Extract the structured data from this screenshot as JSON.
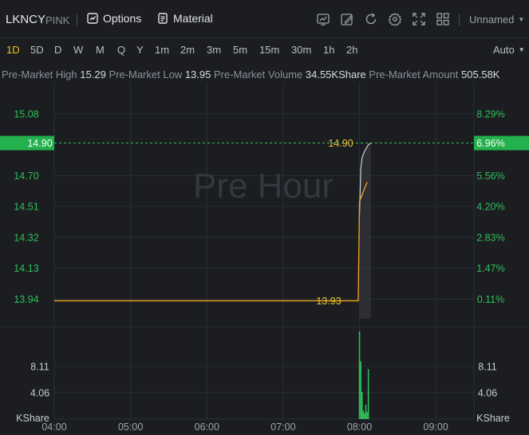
{
  "symbol": "LKNCY",
  "exchange": "PINK",
  "toolbar": {
    "options_label": "Options",
    "material_label": "Material",
    "layout_label": "Unnamed",
    "icons": [
      "indicator-icon",
      "draw-icon",
      "refresh-icon",
      "settings-icon",
      "fullscreen-icon",
      "layout-grid-icon"
    ]
  },
  "periods": [
    "1D",
    "5D",
    "D",
    "W",
    "M",
    "Q",
    "Y",
    "1m",
    "2m",
    "3m",
    "5m",
    "15m",
    "30m",
    "1h",
    "2h"
  ],
  "active_period": "1D",
  "scale_mode": "Auto",
  "stats": {
    "high_label": "Pre-Market High",
    "high": "15.29",
    "low_label": "Pre-Market Low",
    "low": "13.95",
    "volume_label": "Pre-Market Volume",
    "volume": "34.55KShare",
    "amount_label": "Pre-Market Amount",
    "amount": "505.58K"
  },
  "watermark": "Pre Hour",
  "colors": {
    "price_line": "#f5a623",
    "avg_line": "#d0d4da",
    "up": "#2fbf5a",
    "highlight": "#23b04d",
    "tag_text": "#e8c532",
    "grid": "#2a2e34"
  },
  "chart_data": {
    "type": "line",
    "x_ticks": [
      "04:00",
      "05:00",
      "06:00",
      "07:00",
      "08:00",
      "09:00"
    ],
    "y_left_ticks": [
      "15.08",
      "14.70",
      "14.51",
      "14.32",
      "14.13",
      "13.94"
    ],
    "y_right_ticks": [
      "8.29%",
      "5.56%",
      "4.20%",
      "2.83%",
      "1.47%",
      "0.11%"
    ],
    "ylim": [
      13.82,
      15.27
    ],
    "current_price": "14.90",
    "current_change": "6.96%",
    "low_tag": "13.93",
    "high_tag": "14.90",
    "price_series": [
      {
        "t": "04:00",
        "v": 13.93
      },
      {
        "t": "07:00",
        "v": 13.93
      },
      {
        "t": "07:59",
        "v": 13.93
      },
      {
        "t": "08:00",
        "v": 14.54
      },
      {
        "t": "08:03",
        "v": 14.6
      },
      {
        "t": "08:06",
        "v": 14.66
      }
    ],
    "avg_series": [
      {
        "t": "08:00",
        "v": 14.46
      },
      {
        "t": "08:01",
        "v": 14.74
      },
      {
        "t": "08:02",
        "v": 14.81
      },
      {
        "t": "08:04",
        "v": 14.85
      },
      {
        "t": "08:07",
        "v": 14.89
      },
      {
        "t": "08:09",
        "v": 14.9
      }
    ],
    "volume": {
      "unit": "KShare",
      "ticks": [
        "8.11",
        "4.06"
      ],
      "ylim": [
        0,
        14.0
      ],
      "bars": [
        {
          "t": "08:00",
          "v": 13.5
        },
        {
          "t": "08:01",
          "v": 8.9
        },
        {
          "t": "08:02",
          "v": 4.2
        },
        {
          "t": "08:03",
          "v": 1.3
        },
        {
          "t": "08:04",
          "v": 0.9
        },
        {
          "t": "08:05",
          "v": 2.2
        },
        {
          "t": "08:06",
          "v": 1.1
        },
        {
          "t": "08:07",
          "v": 7.7
        }
      ]
    }
  }
}
